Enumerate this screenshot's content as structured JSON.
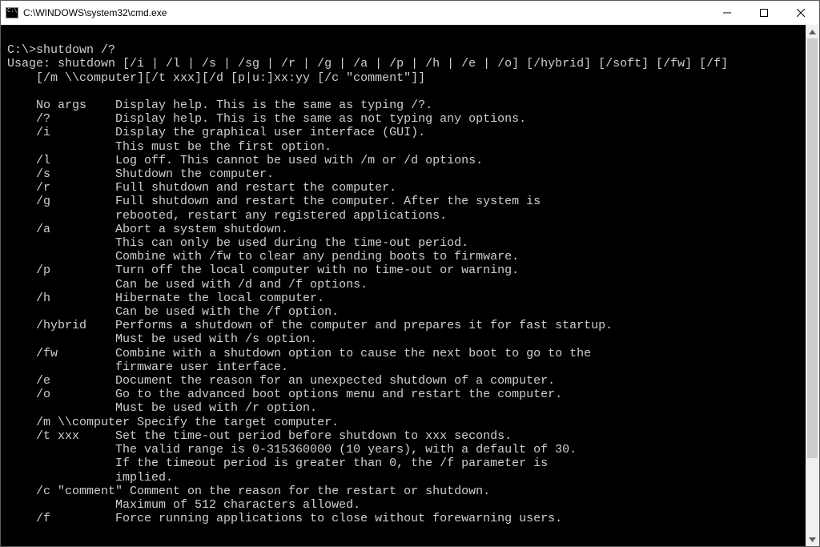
{
  "window": {
    "title": "C:\\WINDOWS\\system32\\cmd.exe"
  },
  "terminal": {
    "lines": [
      "",
      "C:\\>shutdown /?",
      "Usage: shutdown [/i | /l | /s | /sg | /r | /g | /a | /p | /h | /e | /o] [/hybrid] [/soft] [/fw] [/f]",
      "    [/m \\\\computer][/t xxx][/d [p|u:]xx:yy [/c \"comment\"]]",
      "",
      "    No args    Display help. This is the same as typing /?.",
      "    /?         Display help. This is the same as not typing any options.",
      "    /i         Display the graphical user interface (GUI).",
      "               This must be the first option.",
      "    /l         Log off. This cannot be used with /m or /d options.",
      "    /s         Shutdown the computer.",
      "    /r         Full shutdown and restart the computer.",
      "    /g         Full shutdown and restart the computer. After the system is",
      "               rebooted, restart any registered applications.",
      "    /a         Abort a system shutdown.",
      "               This can only be used during the time-out period.",
      "               Combine with /fw to clear any pending boots to firmware.",
      "    /p         Turn off the local computer with no time-out or warning.",
      "               Can be used with /d and /f options.",
      "    /h         Hibernate the local computer.",
      "               Can be used with the /f option.",
      "    /hybrid    Performs a shutdown of the computer and prepares it for fast startup.",
      "               Must be used with /s option.",
      "    /fw        Combine with a shutdown option to cause the next boot to go to the",
      "               firmware user interface.",
      "    /e         Document the reason for an unexpected shutdown of a computer.",
      "    /o         Go to the advanced boot options menu and restart the computer.",
      "               Must be used with /r option.",
      "    /m \\\\computer Specify the target computer.",
      "    /t xxx     Set the time-out period before shutdown to xxx seconds.",
      "               The valid range is 0-315360000 (10 years), with a default of 30.",
      "               If the timeout period is greater than 0, the /f parameter is",
      "               implied.",
      "    /c \"comment\" Comment on the reason for the restart or shutdown.",
      "               Maximum of 512 characters allowed.",
      "    /f         Force running applications to close without forewarning users."
    ]
  }
}
